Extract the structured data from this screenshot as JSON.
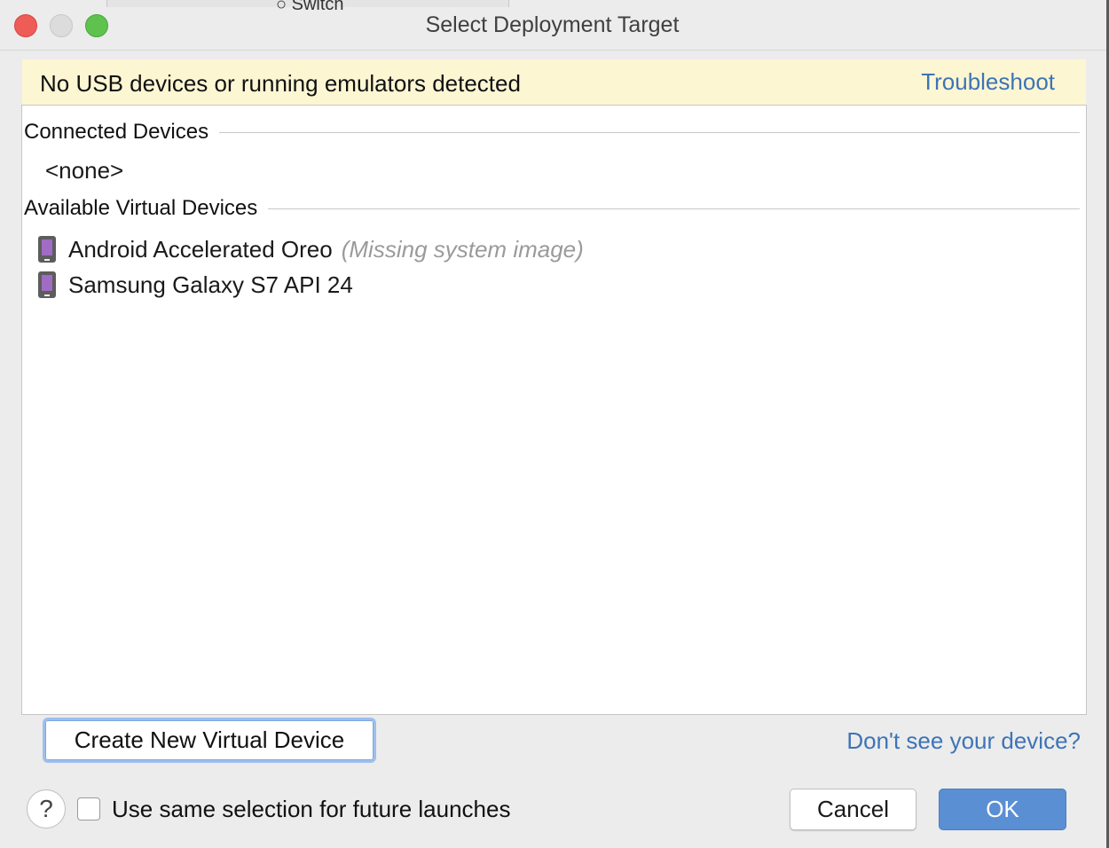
{
  "window": {
    "title": "Select Deployment Target",
    "background_fragment": "○ Switch"
  },
  "banner": {
    "message": "No USB devices or running emulators detected",
    "link_label": "Troubleshoot"
  },
  "connected": {
    "heading": "Connected Devices",
    "empty_label": "<none>"
  },
  "virtual": {
    "heading": "Available Virtual Devices",
    "devices": [
      {
        "name": "Android Accelerated Oreo",
        "note": "(Missing system image)",
        "icon": "phone-icon"
      },
      {
        "name": "Samsung Galaxy S7 API 24",
        "note": "",
        "icon": "phone-icon"
      }
    ]
  },
  "footer": {
    "create_label": "Create New Virtual Device",
    "help_link": "Don't see your device?",
    "help_icon": "?",
    "checkbox_label": "Use same selection for future launches",
    "checkbox_checked": false,
    "cancel_label": "Cancel",
    "ok_label": "OK"
  },
  "colors": {
    "banner_bg": "#fdf6d3",
    "link": "#3d74b6",
    "primary_button": "#5b8fd3",
    "device_screen": "#a06cc4"
  }
}
